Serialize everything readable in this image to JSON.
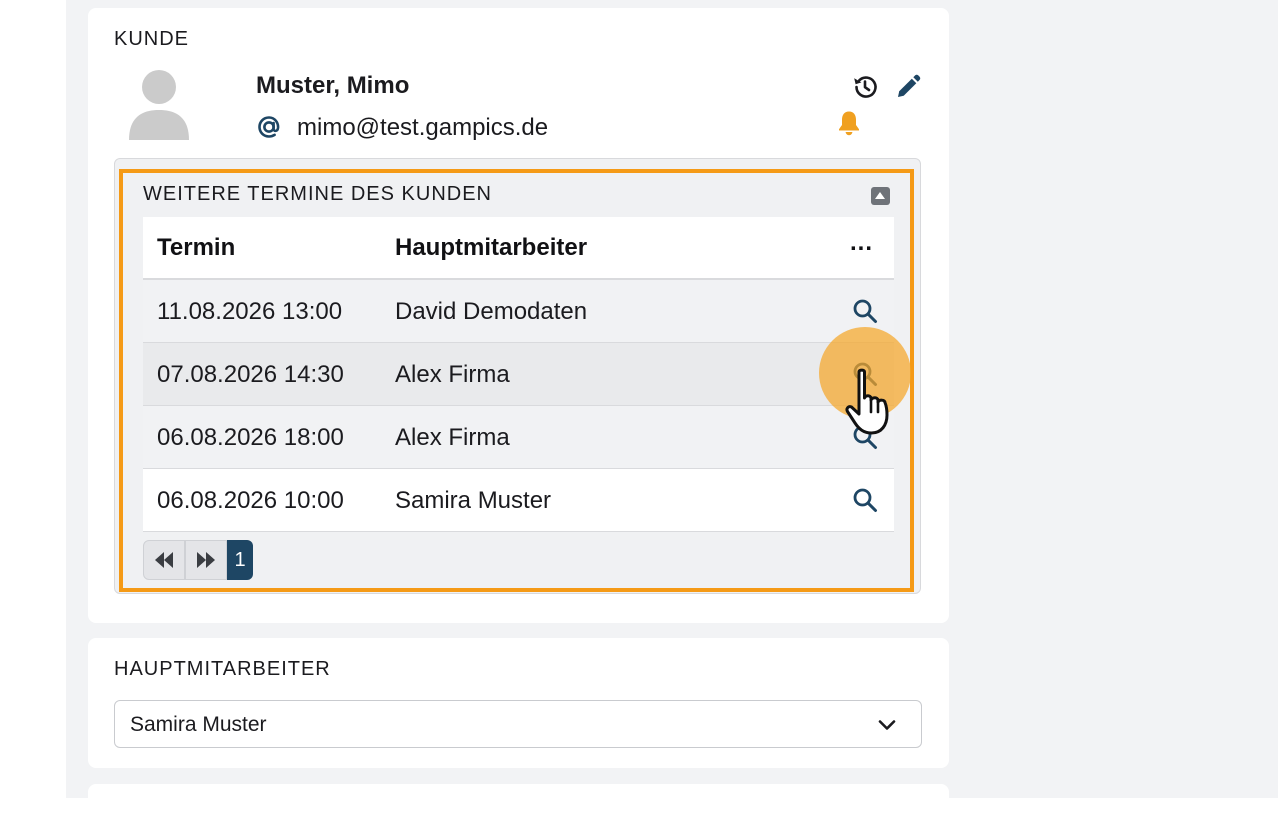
{
  "kunde_section": {
    "title": "KUNDE",
    "customer_name": "Muster, Mimo",
    "email": "mimo@test.gampics.de",
    "email_icon": "at-icon",
    "actions": {
      "history_icon": "history-icon",
      "edit_icon": "pencil-icon",
      "notification_icon": "bell-icon"
    },
    "avatar_icon": "user-avatar-icon"
  },
  "appointments_panel": {
    "title": "WEITERE TERMINE DES KUNDEN",
    "columns": {
      "termin": "Termin",
      "hauptmitarbeiter": "Hauptmitarbeiter",
      "more": "..."
    },
    "rows": [
      {
        "termin": "11.08.2026 13:00",
        "hauptmitarbeiter": "David Demodaten"
      },
      {
        "termin": "07.08.2026 14:30",
        "hauptmitarbeiter": "Alex Firma"
      },
      {
        "termin": "06.08.2026 18:00",
        "hauptmitarbeiter": "Alex Firma"
      },
      {
        "termin": "06.08.2026 10:00",
        "hauptmitarbeiter": "Samira Muster"
      }
    ],
    "pagination": {
      "current_page": "1"
    }
  },
  "hauptmitarbeiter_section": {
    "title": "HAUPTMITARBEITER",
    "selected": "Samira Muster"
  },
  "colors": {
    "highlight": "#f59a16",
    "bell": "#f0a020",
    "icon_blue": "#1e4664",
    "page_active": "#1e4664",
    "click_indicator": "#f5a628"
  }
}
